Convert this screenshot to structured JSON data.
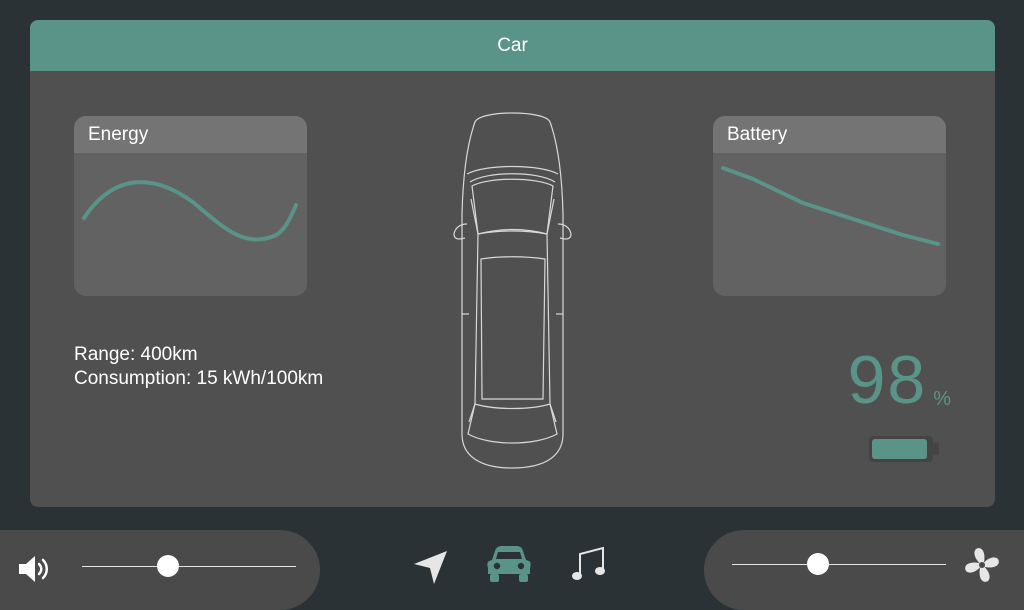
{
  "header": {
    "title": "Car"
  },
  "energy": {
    "title": "Energy"
  },
  "battery": {
    "title": "Battery",
    "percent": "98",
    "unit": "%",
    "level": 0.98
  },
  "stats": {
    "range": "Range: 400km",
    "consumption": "Consumption: 15 kWh/100km"
  },
  "volume": {
    "level": 0.4
  },
  "fan": {
    "level": 0.4
  },
  "nav": {
    "active": "car"
  },
  "colors": {
    "accent": "#5a9387",
    "panel": "#505050",
    "background": "#2b3235"
  },
  "icons": {
    "volume": "volume-icon",
    "navigation": "navigation-arrow-icon",
    "car": "car-icon",
    "music": "music-note-icon",
    "fan": "fan-icon"
  }
}
